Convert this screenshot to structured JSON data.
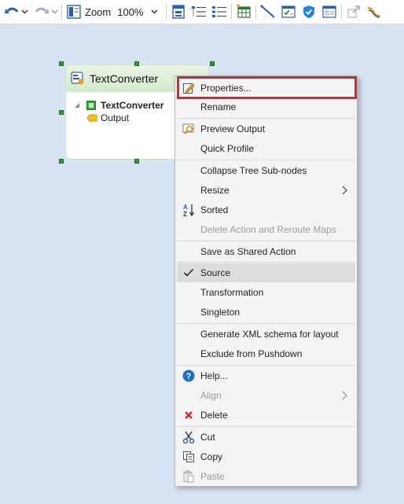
{
  "toolbar": {
    "zoom_label": "Zoom",
    "zoom_value": "100%",
    "icons": [
      "undo-icon",
      "redo-icon",
      "layout-icon",
      "zoom-label",
      "diagram-icon",
      "tree-list-icon",
      "tree-list2-icon",
      "grid-table-icon",
      "line-icon",
      "form-icon",
      "shield-icon",
      "window-icon",
      "expand-icon",
      "route-icon"
    ]
  },
  "node": {
    "title": "TextConverter",
    "tree_root": "TextConverter",
    "tree_child": "Output"
  },
  "menu": {
    "items": [
      {
        "label": "Properties...",
        "icon": "edit-icon",
        "enabled": true
      },
      {
        "label": "Rename",
        "enabled": true
      },
      {
        "label": "Preview Output",
        "icon": "preview-icon",
        "enabled": true
      },
      {
        "label": "Quick Profile",
        "enabled": true
      },
      {
        "label": "Collapse Tree Sub-nodes",
        "enabled": true
      },
      {
        "label": "Resize",
        "enabled": true,
        "submenu": true
      },
      {
        "label": "Sorted",
        "icon": "sort-az-icon",
        "enabled": true
      },
      {
        "label": "Delete Action and Reroute Maps",
        "enabled": false
      },
      {
        "label": "Save as Shared Action",
        "enabled": true
      },
      {
        "label": "Source",
        "enabled": true,
        "checked": true
      },
      {
        "label": "Transformation",
        "enabled": true
      },
      {
        "label": "Singleton",
        "enabled": true
      },
      {
        "label": "Generate XML schema for layout",
        "enabled": true
      },
      {
        "label": "Exclude from Pushdown",
        "enabled": true
      },
      {
        "label": "Help...",
        "icon": "help-icon",
        "enabled": true
      },
      {
        "label": "Align",
        "enabled": false,
        "submenu": true
      },
      {
        "label": "Delete",
        "icon": "delete-icon",
        "enabled": true
      },
      {
        "label": "Cut",
        "icon": "scissors-icon",
        "enabled": true
      },
      {
        "label": "Copy",
        "icon": "copy-icon",
        "enabled": true
      },
      {
        "label": "Paste",
        "icon": "paste-icon",
        "enabled": false
      }
    ]
  },
  "colors": {
    "canvas_bg": "#d6e4f3",
    "highlight_border": "#d9262e",
    "menu_bg": "#f4f4f4",
    "help_blue": "#1f6fc5",
    "delete_red": "#d9262e"
  }
}
